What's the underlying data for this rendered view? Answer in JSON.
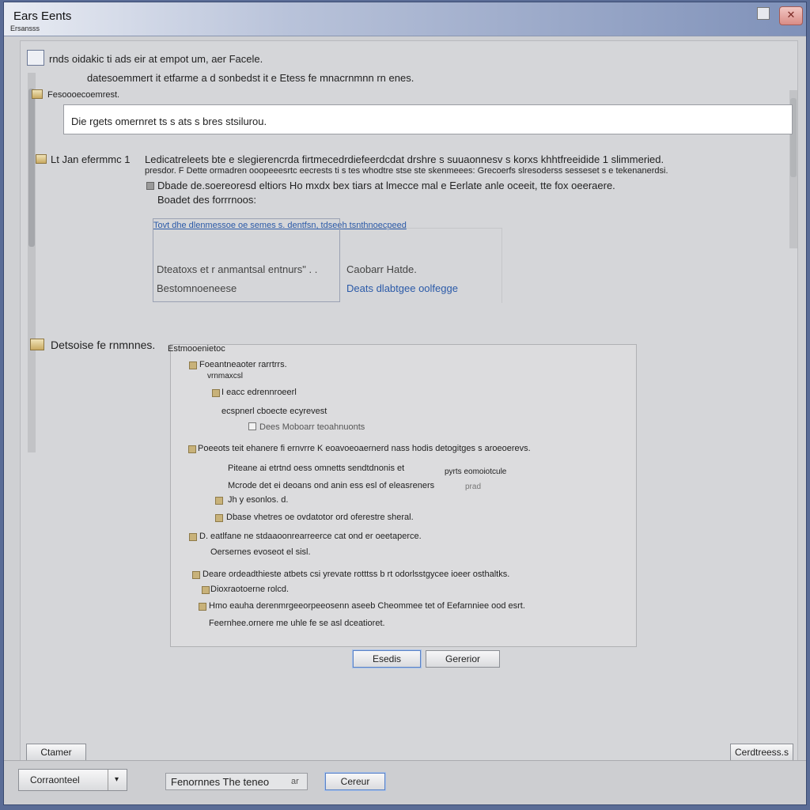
{
  "window": {
    "title": "Ears Eents",
    "subtitle": "Ersansss"
  },
  "section1": {
    "line1": "rnds oidakic ti ads eir at empot um, aer Facele.",
    "line2": "datesoemmert it etfarme a d sonbedst it e Etess fe mnacrnmnn rn enes."
  },
  "section2": {
    "label": "Fesoooecoemrest.",
    "field_value": "Die rgets omernret ts s ats s bres stsilurou."
  },
  "section3": {
    "label": "Lt Jan efermmc 1",
    "line1": "Ledicatreleets bte e slegierencrda firtmecedrdiefeerdcdat drshre s suuaonnesv s korxs khhtfreeidide 1 slimmeried.",
    "line2": "presdor. F Dette ormadren ooopeeesrtc eecrests ti s tes whodtre stse ste skenmeees: Grecoerfs slresoderss sesseset s e tekenanerdsi.",
    "line3": "Dbade de.soereoresd eltiors Ho mxdx bex tiars at lmecce mal e Eerlate anle oceeit, tte fox oeeraere.",
    "line4": "Boadet des forrrnoos:",
    "link": "Tovt dhe dlenmessoe oe semes s. dentfsn, tdseeh tsnthnoecpeed",
    "preview_left1": "Dteatoxs et r anmantsal entnurs\" . .",
    "preview_left2": "Bestomnoeneese",
    "preview_right1": "Caobarr Hatde.",
    "preview_right2": "Deats dlabtgee oolfegge"
  },
  "section4": {
    "label": "Detsoise fe rnmnnes.",
    "panel_header": "Estmooenietoc",
    "items": {
      "i1": "Foeantneaoter rarrtrrs.",
      "i1b": "vrnmaxcsl",
      "i2": "I eacc edrennroeerl",
      "i3": "ecspnerl cboecte ecyrevest",
      "i4": "Dees Moboarr teoahnuonts",
      "i5": "Poeeots teit ehanere fi ernvrre K eoavoeoaernerd nass hodis detogitges s aroeoerevs.",
      "i6": "Piteane ai etrtnd oess omnetts sendtdnonis et",
      "i6b": "pyrts eomoiotcule",
      "i7": "Mcrode det ei deoans ond anin ess esl of eleasreners",
      "i7b": "prad",
      "i8": "Jh y esonlos. d.",
      "i9": "Dbase vhetres oe ovdatotor ord oferestre sheral.",
      "i10": "D. eatlfane ne stdaaoonrearreerce cat ond er oeetaperce.",
      "i10b": "Oersernes evoseot el sisl.",
      "i11": "Deare ordeadthieste atbets csi yrevate rotttss b rt odorlsstgycee ioeer osthaltks.",
      "i11b": "Dioxraotoerne rolcd.",
      "i12": "Hmo eauha derenmrgeeorpeeosenn aseeb Cheommee tet of Eefarnniee ood esrt.",
      "i13": "Feernhee.ornere me uhle fe se asl dceatioret."
    },
    "ok_button": "Esedis",
    "cancel_button": "Gererior"
  },
  "bottom": {
    "left_button": "Ctamer",
    "right_button": "Cerdtreess.s"
  },
  "statusbar": {
    "combo_value": "Corraonteel",
    "text_field": "Fenornnes  The teneo",
    "text_suffix": "ar",
    "button": "Cereur"
  }
}
